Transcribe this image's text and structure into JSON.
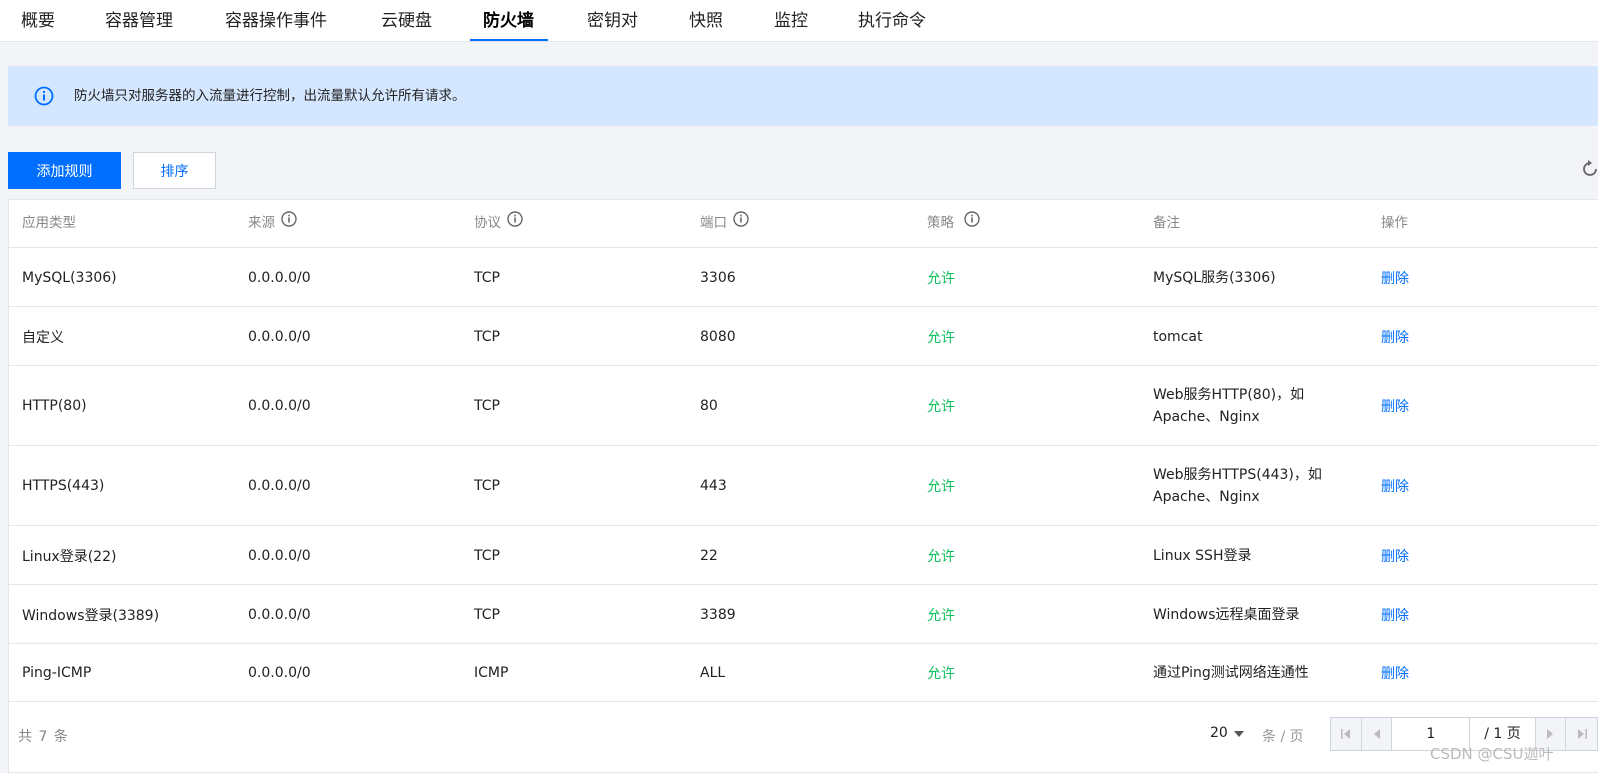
{
  "tabs": [
    {
      "label": "概要"
    },
    {
      "label": "容器管理"
    },
    {
      "label": "容器操作事件"
    },
    {
      "label": "云硬盘"
    },
    {
      "label": "防火墙",
      "active": true
    },
    {
      "label": "密钥对"
    },
    {
      "label": "快照"
    },
    {
      "label": "监控"
    },
    {
      "label": "执行命令"
    }
  ],
  "notice": {
    "icon": "info-icon",
    "text": "防火墙只对服务器的入流量进行控制，出流量默认允许所有请求。"
  },
  "toolbar": {
    "add_label": "添加规则",
    "sort_label": "排序",
    "refresh_icon": "refresh-icon"
  },
  "table": {
    "headers": {
      "type": "应用类型",
      "source": "来源",
      "protocol": "协议",
      "port": "端口",
      "policy": "策略",
      "note": "备注",
      "action": "操作"
    },
    "rows": [
      {
        "type": "MySQL(3306)",
        "source": "0.0.0.0/0",
        "protocol": "TCP",
        "port": "3306",
        "policy": "允许",
        "note": "MySQL服务(3306)",
        "action": "删除"
      },
      {
        "type": "自定义",
        "source": "0.0.0.0/0",
        "protocol": "TCP",
        "port": "8080",
        "policy": "允许",
        "note": "tomcat",
        "action": "删除"
      },
      {
        "type": "HTTP(80)",
        "source": "0.0.0.0/0",
        "protocol": "TCP",
        "port": "80",
        "policy": "允许",
        "note": "Web服务HTTP(80)，如Apache、Nginx",
        "action": "删除"
      },
      {
        "type": "HTTPS(443)",
        "source": "0.0.0.0/0",
        "protocol": "TCP",
        "port": "443",
        "policy": "允许",
        "note": "Web服务HTTPS(443)，如Apache、Nginx",
        "action": "删除"
      },
      {
        "type": "Linux登录(22)",
        "source": "0.0.0.0/0",
        "protocol": "TCP",
        "port": "22",
        "policy": "允许",
        "note": "Linux SSH登录",
        "action": "删除"
      },
      {
        "type": "Windows登录(3389)",
        "source": "0.0.0.0/0",
        "protocol": "TCP",
        "port": "3389",
        "policy": "允许",
        "note": "Windows远程桌面登录",
        "action": "删除"
      },
      {
        "type": "Ping-ICMP",
        "source": "0.0.0.0/0",
        "protocol": "ICMP",
        "port": "ALL",
        "policy": "允许",
        "note": "通过Ping测试网络连通性",
        "action": "删除"
      }
    ]
  },
  "footer": {
    "total": "共 7 条",
    "page_size": "20",
    "page_size_unit": "条 / 页",
    "current_page": "1",
    "total_pages": "/ 1 页"
  },
  "watermark": "CSDN @CSU迦叶",
  "colors": {
    "accent": "#006eff",
    "allow": "#0abf5b",
    "notice_bg": "#d5e7ff"
  }
}
